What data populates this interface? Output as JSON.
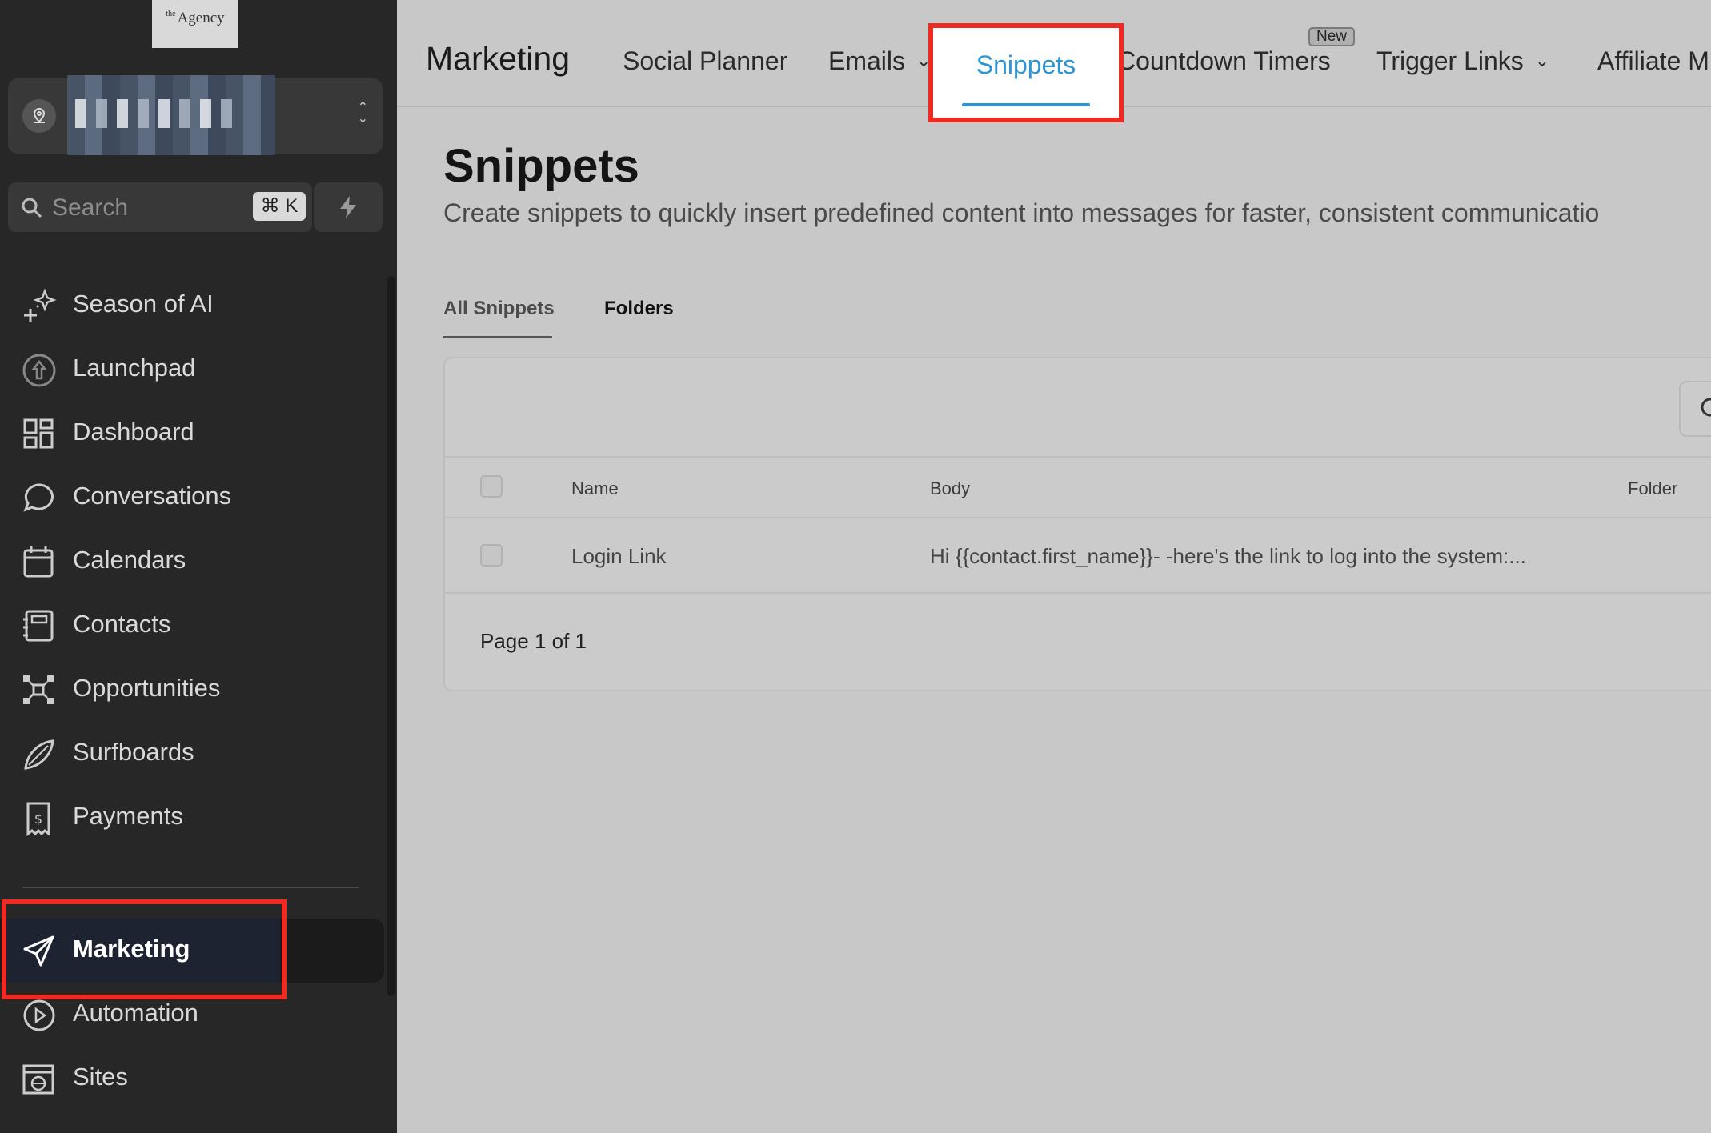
{
  "sidebar": {
    "logo": {
      "prefix": "the",
      "name": "Agency"
    },
    "search": {
      "placeholder": "Search",
      "shortcut": "⌘ K"
    },
    "items": [
      {
        "label": "Season of AI",
        "icon": "sparkles-icon"
      },
      {
        "label": "Launchpad",
        "icon": "rocket-icon"
      },
      {
        "label": "Dashboard",
        "icon": "dashboard-grid-icon"
      },
      {
        "label": "Conversations",
        "icon": "chat-bubble-icon"
      },
      {
        "label": "Calendars",
        "icon": "calendar-icon"
      },
      {
        "label": "Contacts",
        "icon": "contact-card-icon"
      },
      {
        "label": "Opportunities",
        "icon": "network-icon"
      },
      {
        "label": "Surfboards",
        "icon": "surfboard-icon"
      },
      {
        "label": "Payments",
        "icon": "receipt-dollar-icon"
      },
      {
        "label": "Marketing",
        "icon": "send-plane-icon",
        "active": true
      },
      {
        "label": "Automation",
        "icon": "play-circle-icon"
      },
      {
        "label": "Sites",
        "icon": "globe-browser-icon"
      }
    ]
  },
  "topnav": {
    "section": "Marketing",
    "tabs": [
      {
        "label": "Social Planner"
      },
      {
        "label": "Emails"
      },
      {
        "label": "Snippets",
        "active": true
      },
      {
        "label": "Countdown Timers",
        "badge": "New"
      },
      {
        "label": "Trigger Links"
      },
      {
        "label": "Affiliate M"
      }
    ]
  },
  "main": {
    "title": "Snippets",
    "subtitle": "Create snippets to quickly insert predefined content into messages for faster, consistent communicatio",
    "subtabs": [
      "All Snippets",
      "Folders"
    ],
    "table": {
      "columns": [
        "Name",
        "Body",
        "Folder"
      ],
      "rows": [
        {
          "name": "Login Link",
          "body": "Hi {{contact.first_name}}- -here's the link to log into the system:..."
        }
      ],
      "pager": "Page 1 of 1"
    }
  },
  "colors": {
    "highlight": "#ee2a22",
    "accent": "#2b95d6",
    "sidebar_bg": "#272727",
    "content_bg": "#c8c8c8"
  }
}
